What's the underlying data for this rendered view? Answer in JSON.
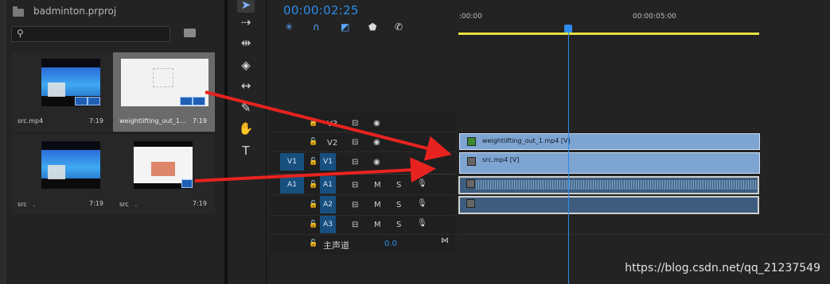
{
  "project": {
    "name": "badminton.prproj",
    "search": {
      "placeholder": "",
      "value": ""
    },
    "items": [
      {
        "name": "src.mp4",
        "duration": "7:19"
      },
      {
        "name": "weightlifting_out_1...",
        "duration": "7:19"
      },
      {
        "name": "src　.",
        "duration": "7:19"
      },
      {
        "name": "src　.",
        "duration": "7:19"
      }
    ]
  },
  "tools": [
    "selection-tool",
    "track-select-tool",
    "ripple-edit-tool",
    "razor-tool",
    "slip-tool",
    "pen-tool",
    "hand-tool",
    "type-tool"
  ],
  "timeline": {
    "timecode": "00:00:02:25",
    "ruler": [
      " :00:00",
      "00:00:05:00"
    ],
    "video_tracks": [
      {
        "source": "",
        "target": "",
        "name": "V3"
      },
      {
        "source": "",
        "target": "",
        "name": "V2"
      },
      {
        "source": "V1",
        "target": "V1",
        "name": "V1"
      }
    ],
    "audio_tracks": [
      {
        "source": "A1",
        "target": "A1",
        "m": "M",
        "s": "S"
      },
      {
        "source": "",
        "target": "A2",
        "m": "M",
        "s": "S"
      },
      {
        "source": "",
        "target": "A3",
        "m": "M",
        "s": "S"
      }
    ],
    "master": {
      "label": "主声道",
      "value": "0.0"
    },
    "clips": {
      "v2": "weightlifting_out_1.mp4 [V]",
      "v1": "src.mp4 [V]"
    }
  },
  "watermark": "https://blog.csdn.net/qq_21237549",
  "colors": {
    "accent": "#2d8ceb",
    "clip_video": "#7ea4d2",
    "in_out_bar": "#e6e040",
    "arrow": "#e8231f"
  }
}
